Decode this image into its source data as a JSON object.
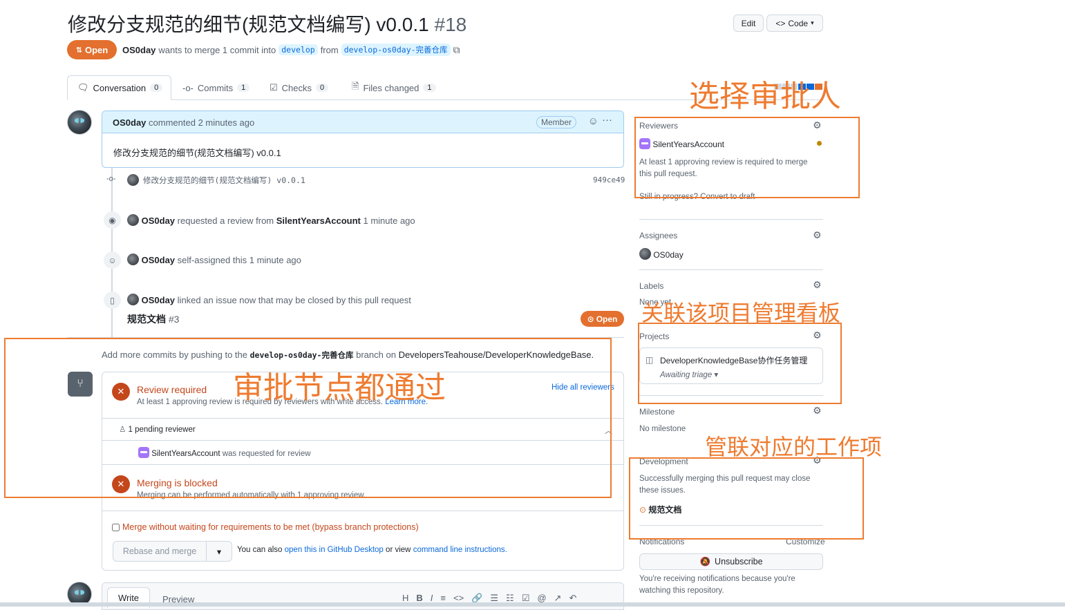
{
  "header": {
    "title": "修改分支规范的细节(规范文档编写) v0.0.1",
    "number": "#18",
    "edit_label": "Edit",
    "code_label": "Code",
    "state_label": "Open",
    "author": "OS0day",
    "merge_text": "wants to merge 1 commit into",
    "base_branch": "develop",
    "from_text": "from",
    "head_branch": "develop-os0day-完善仓库"
  },
  "tabs": [
    {
      "label": "Conversation",
      "count": "0"
    },
    {
      "label": "Commits",
      "count": "1"
    },
    {
      "label": "Checks",
      "count": "0"
    },
    {
      "label": "Files changed",
      "count": "1"
    }
  ],
  "comment": {
    "author": "OS0day",
    "action": "commented 2 minutes ago",
    "badge": "Member",
    "body": "修改分支规范的细节(规范文档编写) v0.0.1"
  },
  "timeline": {
    "commit": {
      "message": "修改分支规范的细节(规范文档编写) v0.0.1",
      "sha": "949ce49"
    },
    "review_request": {
      "actor": "OS0day",
      "text1": "requested a review from",
      "target": "SilentYearsAccount",
      "time": "1 minute ago"
    },
    "self_assign": {
      "actor": "OS0day",
      "text": "self-assigned this 1 minute ago"
    },
    "linked_issue": {
      "actor": "OS0day",
      "text": "linked an issue now that may be closed by this pull request",
      "issue_title": "规范文档",
      "issue_number": "#3",
      "issue_state": "Open"
    }
  },
  "merge": {
    "hint_prefix": "Add more commits by pushing to the",
    "hint_branch": "develop-os0day-完善仓库",
    "hint_mid": "branch on",
    "hint_repo": "DevelopersTeahouse/DeveloperKnowledgeBase.",
    "review_title": "Review required",
    "review_sub": "At least 1 approving review is required by reviewers with write access.",
    "learn_more": "Learn more.",
    "hide_reviewers": "Hide all reviewers",
    "pending": "1 pending reviewer",
    "reviewer": "SilentYearsAccount",
    "reviewer_text": "was requested for review",
    "blocked_title": "Merging is blocked",
    "blocked_sub": "Merging can be performed automatically with 1 approving review.",
    "bypass": "Merge without waiting for requirements to be met (bypass branch protections)",
    "rebase_label": "Rebase and merge",
    "also_prefix": "You can also",
    "desktop_link": "open this in GitHub Desktop",
    "or_view": "or view",
    "cli_link": "command line instructions."
  },
  "editor": {
    "write_tab": "Write",
    "preview_tab": "Preview",
    "toolbar": [
      "H",
      "B",
      "I",
      "≡",
      "<>",
      "<>",
      "🔗",
      "☰",
      "☷",
      "☑",
      "@",
      "↗",
      "↶"
    ]
  },
  "sidebar": {
    "reviewers_label": "Reviewers",
    "reviewer_name": "SilentYearsAccount",
    "reviewers_note": "At least 1 approving review is required to merge this pull request.",
    "convert_draft": "Still in progress? Convert to draft",
    "assignees_label": "Assignees",
    "assignee": "OS0day",
    "labels_label": "Labels",
    "labels_value": "None yet",
    "projects_label": "Projects",
    "project_name": "DeveloperKnowledgeBase协作任务管理",
    "project_status": "Awaiting triage",
    "milestone_label": "Milestone",
    "milestone_value": "No milestone",
    "development_label": "Development",
    "development_note": "Successfully merging this pull request may close these issues.",
    "development_issue": "规范文档",
    "notifications_label": "Notifications",
    "customize": "Customize",
    "unsubscribe": "Unsubscribe",
    "notif_note": "You're receiving notifications because you're watching this repository."
  },
  "annotations": {
    "select_reviewer": "选择审批人",
    "link_board": "关联该项目管理看板",
    "review_pass": "审批节点都通过",
    "link_work_item": "管联对应的工作项"
  },
  "colors": {
    "accent_orange": "#ee7b30",
    "state_orange": "#e3702e",
    "link_blue": "#0969da"
  }
}
